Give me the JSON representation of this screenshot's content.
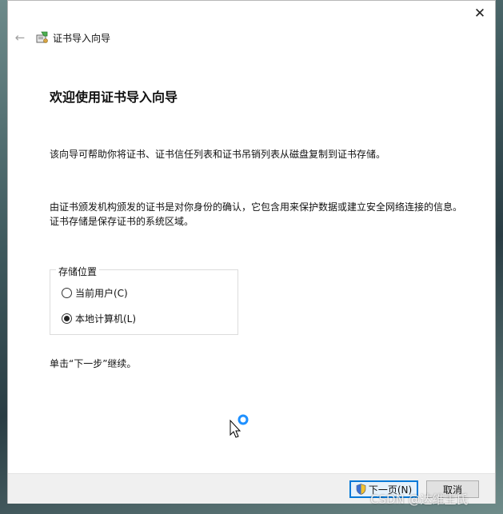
{
  "window": {
    "title": "证书导入向导",
    "close_glyph": "✕",
    "back_glyph": "←"
  },
  "content": {
    "heading": "欢迎使用证书导入向导",
    "paragraph1": "该向导可帮助你将证书、证书信任列表和证书吊销列表从磁盘复制到证书存储。",
    "paragraph2": "由证书颁发机构颁发的证书是对你身份的确认，它包含用来保护数据或建立安全网络连接的信息。证书存储是保存证书的系统区域。",
    "continue_text": "单击“下一步”继续。"
  },
  "storage": {
    "legend": "存储位置",
    "options": [
      {
        "label": "当前用户(C)",
        "checked": false
      },
      {
        "label": "本地计算机(L)",
        "checked": true
      }
    ]
  },
  "buttons": {
    "next_label": "下一页(N)",
    "cancel_label": "取消"
  },
  "watermark": "CSDN @达维王氏",
  "colors": {
    "accent": "#0078d7",
    "busy_cursor_ring": "#1e90ff"
  }
}
